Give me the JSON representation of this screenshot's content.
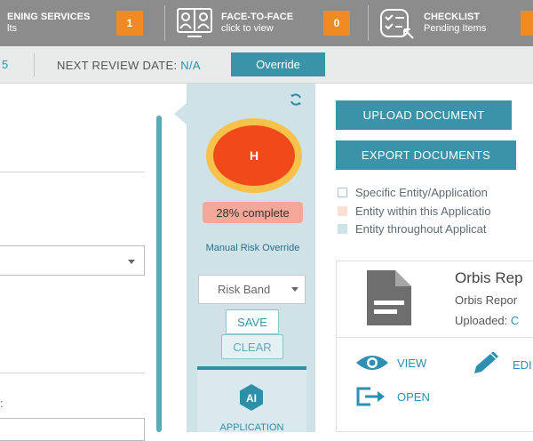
{
  "topbar": {
    "screening": {
      "title": "ENING SERVICES",
      "sub": "lts",
      "count": "1"
    },
    "face_to_face": {
      "title": "FACE-TO-FACE",
      "sub": "click to view",
      "count": "0"
    },
    "checklist": {
      "title": "CHECKLIST",
      "sub": "Pending Items"
    }
  },
  "subbar": {
    "left_fragment": "5",
    "review_label": "NEXT REVIEW DATE:",
    "review_value": "N/A",
    "override_label": "Override"
  },
  "left_panel": {
    "field_fragment": ":"
  },
  "risk": {
    "letter": "H",
    "progress_percent": 28,
    "progress_text": "28% complete",
    "manual_override_label": "Manual Risk Override",
    "risk_band_placeholder": "Risk Band",
    "save_label": "SAVE",
    "clear_label": "CLEAR",
    "ai_badge": "AI",
    "ai_label": "APPLICATION"
  },
  "documents": {
    "upload_label": "UPLOAD DOCUMENT",
    "export_label": "EXPORT DOCUMENTS",
    "legend": [
      {
        "label": "Specific Entity/Application",
        "color": "#ffffff"
      },
      {
        "label": "Entity within this Applicatio",
        "color": "#fbe1d3"
      },
      {
        "label": "Entity throughout Applicat",
        "color": "#cfe2e8"
      }
    ],
    "card": {
      "title": "Orbis Rep",
      "subtitle": "Orbis Repor",
      "uploaded_label": "Uploaded:",
      "uploaded_value": "C",
      "view_label": "VIEW",
      "edit_label": "EDI",
      "open_label": "OPEN"
    }
  },
  "colors": {
    "accent": "#3a93a9",
    "risk_high": "#f14a1a",
    "risk_ring": "#f7c24a",
    "badge": "#f08a22"
  }
}
